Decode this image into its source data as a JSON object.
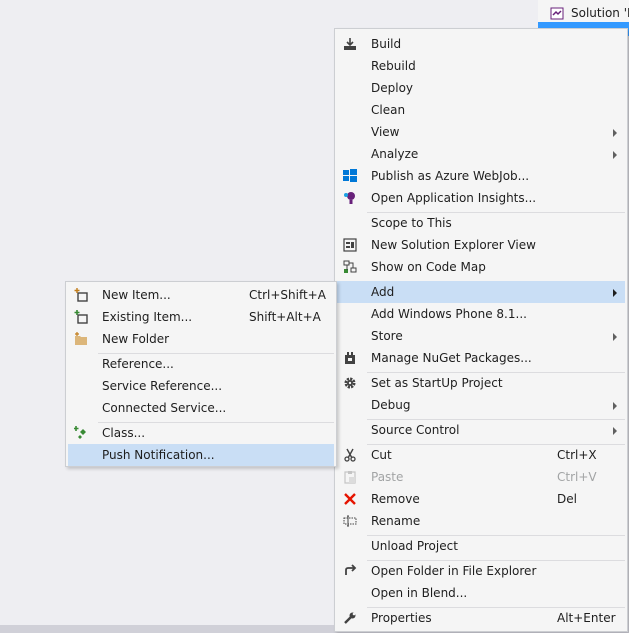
{
  "solution": {
    "title": "Solution 'M"
  },
  "main_menu": {
    "build": {
      "label": "Build"
    },
    "rebuild": {
      "label": "Rebuild"
    },
    "deploy": {
      "label": "Deploy"
    },
    "clean": {
      "label": "Clean"
    },
    "view": {
      "label": "View"
    },
    "analyze": {
      "label": "Analyze"
    },
    "publish_azure": {
      "label": "Publish as Azure WebJob..."
    },
    "app_insights": {
      "label": "Open Application Insights..."
    },
    "scope_to_this": {
      "label": "Scope to This"
    },
    "new_solution_view": {
      "label": "New Solution Explorer View"
    },
    "code_map": {
      "label": "Show on Code Map"
    },
    "add": {
      "label": "Add"
    },
    "add_wp": {
      "label": "Add Windows Phone 8.1..."
    },
    "store": {
      "label": "Store"
    },
    "nuget": {
      "label": "Manage NuGet Packages..."
    },
    "startup": {
      "label": "Set as StartUp Project"
    },
    "debug": {
      "label": "Debug"
    },
    "source_control": {
      "label": "Source Control"
    },
    "cut": {
      "label": "Cut",
      "shortcut": "Ctrl+X"
    },
    "paste": {
      "label": "Paste",
      "shortcut": "Ctrl+V"
    },
    "remove": {
      "label": "Remove",
      "shortcut": "Del"
    },
    "rename": {
      "label": "Rename"
    },
    "unload": {
      "label": "Unload Project"
    },
    "open_folder": {
      "label": "Open Folder in File Explorer"
    },
    "open_blend": {
      "label": "Open in Blend..."
    },
    "properties": {
      "label": "Properties",
      "shortcut": "Alt+Enter"
    }
  },
  "sub_menu": {
    "new_item": {
      "label": "New Item...",
      "shortcut": "Ctrl+Shift+A"
    },
    "existing_item": {
      "label": "Existing Item...",
      "shortcut": "Shift+Alt+A"
    },
    "new_folder": {
      "label": "New Folder"
    },
    "reference": {
      "label": "Reference..."
    },
    "service_reference": {
      "label": "Service Reference..."
    },
    "connected_service": {
      "label": "Connected Service..."
    },
    "class": {
      "label": "Class..."
    },
    "push_notification": {
      "label": "Push Notification..."
    }
  },
  "colors": {
    "highlight": "#c9def5",
    "menu_bg": "#f5f5f5",
    "accent": "#3399ff",
    "remove_red": "#e51400"
  }
}
